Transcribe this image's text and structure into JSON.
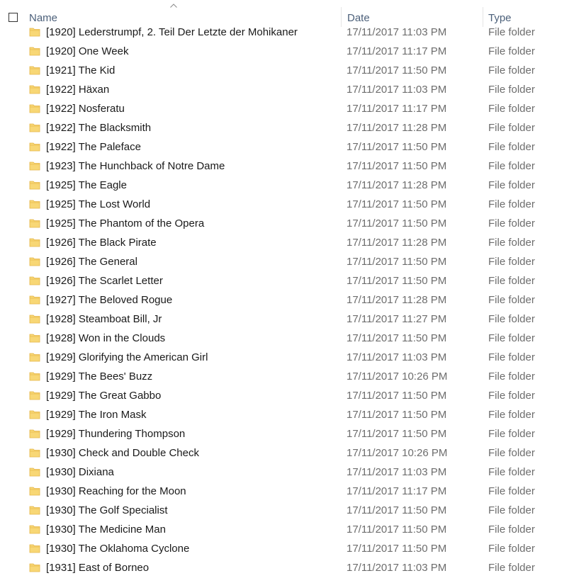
{
  "header": {
    "name_label": "Name",
    "date_label": "Date",
    "type_label": "Type"
  },
  "files": [
    {
      "name": "[1920] Lederstrumpf, 2. Teil Der Letzte der Mohikaner",
      "date": "17/11/2017 11:03 PM",
      "type": "File folder"
    },
    {
      "name": "[1920] One Week",
      "date": "17/11/2017 11:17 PM",
      "type": "File folder"
    },
    {
      "name": "[1921] The Kid",
      "date": "17/11/2017 11:50 PM",
      "type": "File folder"
    },
    {
      "name": "[1922] Häxan",
      "date": "17/11/2017 11:03 PM",
      "type": "File folder"
    },
    {
      "name": "[1922] Nosferatu",
      "date": "17/11/2017 11:17 PM",
      "type": "File folder"
    },
    {
      "name": "[1922] The Blacksmith",
      "date": "17/11/2017 11:28 PM",
      "type": "File folder"
    },
    {
      "name": "[1922] The Paleface",
      "date": "17/11/2017 11:50 PM",
      "type": "File folder"
    },
    {
      "name": "[1923] The Hunchback of Notre Dame",
      "date": "17/11/2017 11:50 PM",
      "type": "File folder"
    },
    {
      "name": "[1925] The Eagle",
      "date": "17/11/2017 11:28 PM",
      "type": "File folder"
    },
    {
      "name": "[1925] The Lost World",
      "date": "17/11/2017 11:50 PM",
      "type": "File folder"
    },
    {
      "name": "[1925] The Phantom of the Opera",
      "date": "17/11/2017 11:50 PM",
      "type": "File folder"
    },
    {
      "name": "[1926] The Black Pirate",
      "date": "17/11/2017 11:28 PM",
      "type": "File folder"
    },
    {
      "name": "[1926] The General",
      "date": "17/11/2017 11:50 PM",
      "type": "File folder"
    },
    {
      "name": "[1926] The Scarlet Letter",
      "date": "17/11/2017 11:50 PM",
      "type": "File folder"
    },
    {
      "name": "[1927] The Beloved Rogue",
      "date": "17/11/2017 11:28 PM",
      "type": "File folder"
    },
    {
      "name": "[1928] Steamboat Bill, Jr",
      "date": "17/11/2017 11:27 PM",
      "type": "File folder"
    },
    {
      "name": "[1928] Won in the Clouds",
      "date": "17/11/2017 11:50 PM",
      "type": "File folder"
    },
    {
      "name": "[1929] Glorifying the American Girl",
      "date": "17/11/2017 11:03 PM",
      "type": "File folder"
    },
    {
      "name": "[1929] The Bees' Buzz",
      "date": "17/11/2017 10:26 PM",
      "type": "File folder"
    },
    {
      "name": "[1929] The Great Gabbo",
      "date": "17/11/2017 11:50 PM",
      "type": "File folder"
    },
    {
      "name": "[1929] The Iron Mask",
      "date": "17/11/2017 11:50 PM",
      "type": "File folder"
    },
    {
      "name": "[1929] Thundering Thompson",
      "date": "17/11/2017 11:50 PM",
      "type": "File folder"
    },
    {
      "name": "[1930] Check and Double Check",
      "date": "17/11/2017 10:26 PM",
      "type": "File folder"
    },
    {
      "name": "[1930] Dixiana",
      "date": "17/11/2017 11:03 PM",
      "type": "File folder"
    },
    {
      "name": "[1930] Reaching for the Moon",
      "date": "17/11/2017 11:17 PM",
      "type": "File folder"
    },
    {
      "name": "[1930] The Golf Specialist",
      "date": "17/11/2017 11:50 PM",
      "type": "File folder"
    },
    {
      "name": "[1930] The Medicine Man",
      "date": "17/11/2017 11:50 PM",
      "type": "File folder"
    },
    {
      "name": "[1930] The Oklahoma Cyclone",
      "date": "17/11/2017 11:50 PM",
      "type": "File folder"
    },
    {
      "name": "[1931] East of Borneo",
      "date": "17/11/2017 11:03 PM",
      "type": "File folder"
    }
  ],
  "colors": {
    "folder_body": "#f8d775",
    "folder_edge": "#e3b341",
    "header_text": "#4c607a",
    "secondary_text": "#6d6d6d"
  },
  "icons": {
    "folder": "folder-icon",
    "sort": "sort-ascending-icon"
  }
}
